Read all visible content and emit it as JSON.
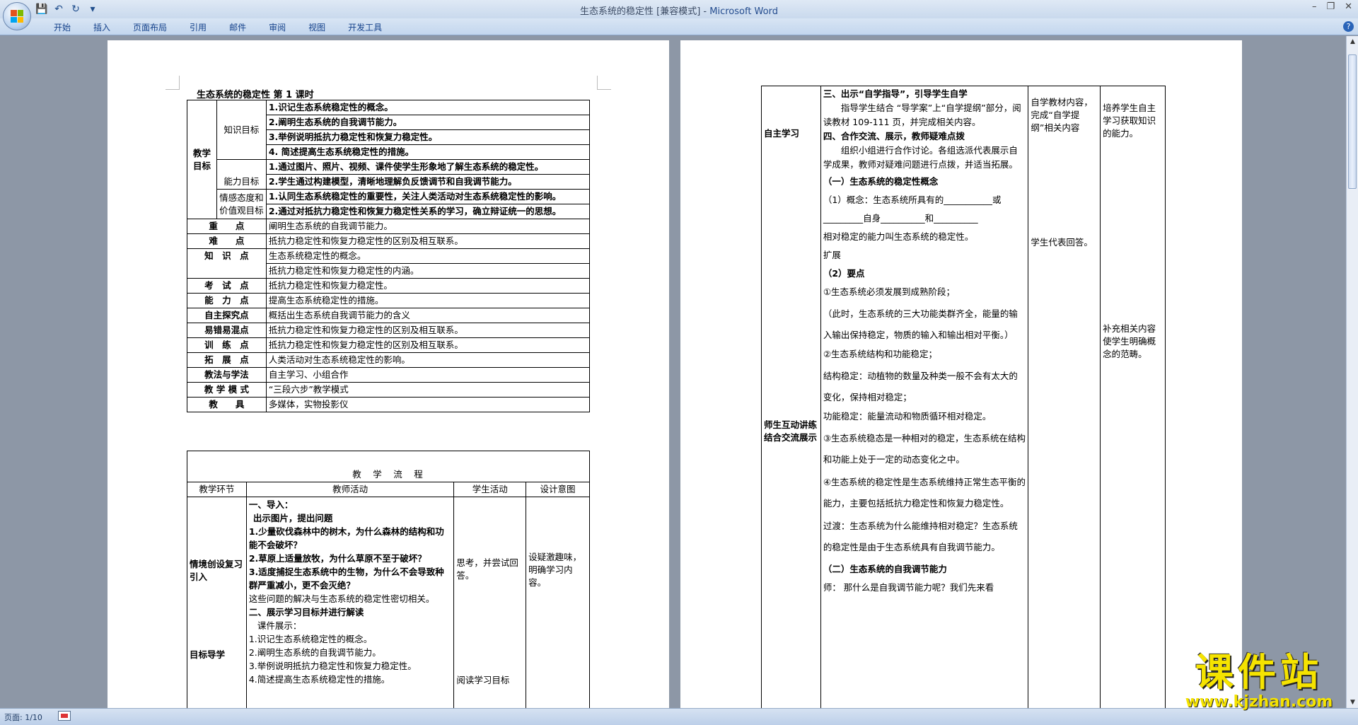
{
  "window": {
    "doc_title": "生态系统的稳定性 [兼容模式]",
    "app_name": "Microsoft Word",
    "separator": " - "
  },
  "qat": {
    "save": "💾",
    "undo": "↶",
    "redo": "↻",
    "more": "▾"
  },
  "ribbon": {
    "tabs": [
      "开始",
      "插入",
      "页面布局",
      "引用",
      "邮件",
      "审阅",
      "视图",
      "开发工具"
    ],
    "help": "?"
  },
  "status": {
    "page": "页面: 1/10"
  },
  "watermark": {
    "title": "课件站",
    "url": "www.kjzhan.com"
  },
  "page1": {
    "heading": "生态系统的稳定性   第 1 课时",
    "goals_label": "教学目标",
    "knowledge_label": "知识目标",
    "knowledge_items": [
      "1.识记生态系统稳定性的概念。",
      "2.阐明生态系统的自我调节能力。",
      "3.举例说明抵抗力稳定性和恢复力稳定性。",
      "4. 简述提高生态系统稳定性的措施。"
    ],
    "ability_label": "能力目标",
    "ability_items": [
      "1.通过图片、照片、视频、课件使学生形象地了解生态系统的稳定性。",
      "2.学生通过构建模型，清晰地理解负反馈调节和自我调节能力。"
    ],
    "emotion_label": "情感态度和价值观目标",
    "emotion_items": [
      "1.认同生态系统稳定性的重要性，关注人类活动对生态系统稳定性的影响。",
      "2.通过对抵抗力稳定性和恢复力稳定性关系的学习，确立辩证统一的思想。"
    ],
    "rows": [
      {
        "label": "重　　点",
        "value": "阐明生态系统的自我调节能力。"
      },
      {
        "label": "难　　点",
        "value": "抵抗力稳定性和恢复力稳定性的区别及相互联系。"
      },
      {
        "label": "知　识　点",
        "value": "生态系统稳定性的概念。"
      },
      {
        "label": "",
        "value": "抵抗力稳定性和恢复力稳定性的内涵。"
      },
      {
        "label": "考　试　点",
        "value": "抵抗力稳定性和恢复力稳定性。"
      },
      {
        "label": "能　力　点",
        "value": "提高生态系统稳定性的措施。"
      },
      {
        "label": "自主探究点",
        "value": "概括出生态系统自我调节能力的含义"
      },
      {
        "label": "易错易混点",
        "value": "抵抗力稳定性和恢复力稳定性的区别及相互联系。"
      },
      {
        "label": "训　练　点",
        "value": "抵抗力稳定性和恢复力稳定性的区别及相互联系。"
      },
      {
        "label": "拓　展　点",
        "value": "人类活动对生态系统稳定性的影响。"
      },
      {
        "label": "教法与学法",
        "value": "自主学习、小组合作"
      },
      {
        "label": "教 学 模 式",
        "value": "“三段六步”教学模式"
      },
      {
        "label": "教　　具",
        "value": "多媒体，实物投影仪"
      }
    ],
    "flow_title": "教　学　流　程",
    "flow_headers": [
      "教学环节",
      "教师活动",
      "学生活动",
      "设计意图"
    ],
    "flow_stage1": "情境创设复习引入",
    "flow_stage2": "目标导学",
    "teacher_lines": [
      "一、导入：",
      "出示图片，提出问题",
      "1.少量砍伐森林中的树木，为什么森林的结构和功能不会破坏？",
      "2.草原上适量放牧，为什么草原不至于破坏？",
      "3.适度捕捉生态系统中的生物，为什么不会导致种群严重减小，更不会灭绝？",
      "这些问题的解决与生态系统的稳定性密切相关。",
      "二、展示学习目标并进行解读",
      "课件展示：",
      "1.识记生态系统稳定性的概念。",
      "2.阐明生态系统的自我调节能力。",
      "3.举例说明抵抗力稳定性和恢复力稳定性。",
      "4.简述提高生态系统稳定性的措施。"
    ],
    "student1": "思考，并尝试回答。",
    "student2": "阅读学习目标",
    "intent1": "设疑激趣味，明确学习内容。"
  },
  "page2": {
    "stage1": "自主学习",
    "stage2": "师生互动讲练结合交流展示",
    "lines": [
      "三、出示“自学指导”，引导学生自学",
      "指导学生结合 “导学案”上“自学提纲”部分，阅读教材 109-111 页，并完成相关内容。",
      "四、合作交流、展示，教师疑难点拨",
      "组织小组进行合作讨论。各组选派代表展示自学成果，教师对疑难问题进行点拨，并适当拓展。",
      "（一）生态系统的稳定性概念",
      "（1）概念：生态系统所具有的___________或",
      "_________自身__________和__________",
      "相对稳定的能力叫生态系统的稳定性。",
      "扩展",
      "（2）要点",
      "①生态系统必须发展到成熟阶段；",
      "（此时，生态系统的三大功能类群齐全，能量的输入输出保持稳定，物质的输入和输出相对平衡。）",
      "②生态系统结构和功能稳定；",
      "结构稳定：动植物的数量及种类一般不会有太大的变化，保持相对稳定；",
      "功能稳定：能量流动和物质循环相对稳定。",
      "③生态系统稳态是一种相对的稳定，生态系统在结构和功能上处于一定的动态变化之中。",
      "④生态系统的稳定性是生态系统维持正常生态平衡的能力，主要包括抵抗力稳定性和恢复力稳定性。",
      "过渡：生态系统为什么能维持相对稳定？生态系统的稳定性是由于生态系统具有自我调节能力。",
      "（二）生态系统的自我调节能力",
      "师：  那什么是自我调节能力呢？我们先来看"
    ],
    "student1": "自学教材内容，完成“自学提纲”相关内容",
    "student2": "学生代表回答。",
    "intent1": "培养学生自主学习获取知识的能力。",
    "intent2": "补充相关内容使学生明确概念的范畴。"
  }
}
